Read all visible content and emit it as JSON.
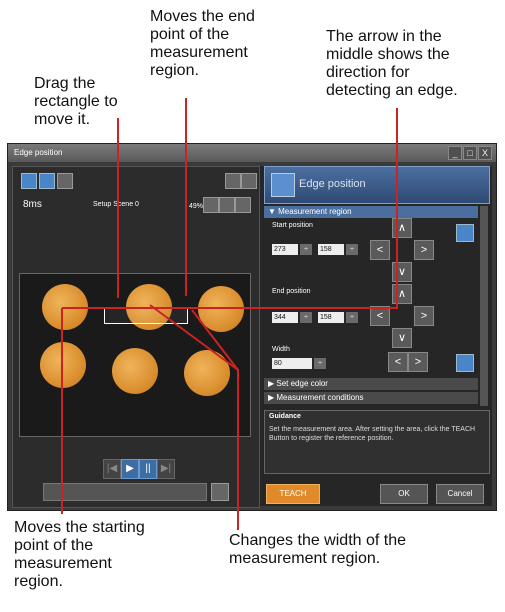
{
  "callouts": {
    "end_point": "Moves the end\npoint of the\nmeasurement\nregion.",
    "arrow": "The arrow in the\nmiddle shows the\ndirection for\ndetecting an edge.",
    "drag": "Drag the\nrectangle to\nmove it.",
    "start_point": "Moves the starting\npoint of the\nmeasurement\nregion.",
    "width": "Changes the width of the\nmeasurement region."
  },
  "window": {
    "title": "Edge position",
    "controls": [
      "_",
      "□",
      "X"
    ]
  },
  "left_panel": {
    "time": "8ms",
    "scene": "Setup Scene 0",
    "zoom": "49%"
  },
  "right_panel": {
    "header": "Edge position",
    "measurement_region": "▼ Measurement region",
    "start_label": "Start position",
    "start_x": "273",
    "start_y": "158",
    "end_label": "End position",
    "end_x": "344",
    "end_y": "158",
    "width_label": "Width",
    "width_value": "80",
    "set_edge_color": "▶ Set edge color",
    "measurement_conditions": "▶ Measurement conditions",
    "guidance_title": "Guidance",
    "guidance_text": "Set the measurement area. After setting the area, click the TEACH Button to register the reference position.",
    "teach_label": "TEACH",
    "ok_label": "OK",
    "cancel_label": "Cancel"
  },
  "colors": {
    "annotation_line": "#cc2222",
    "accent": "#4a86c7",
    "teach": "#e08a2a"
  }
}
